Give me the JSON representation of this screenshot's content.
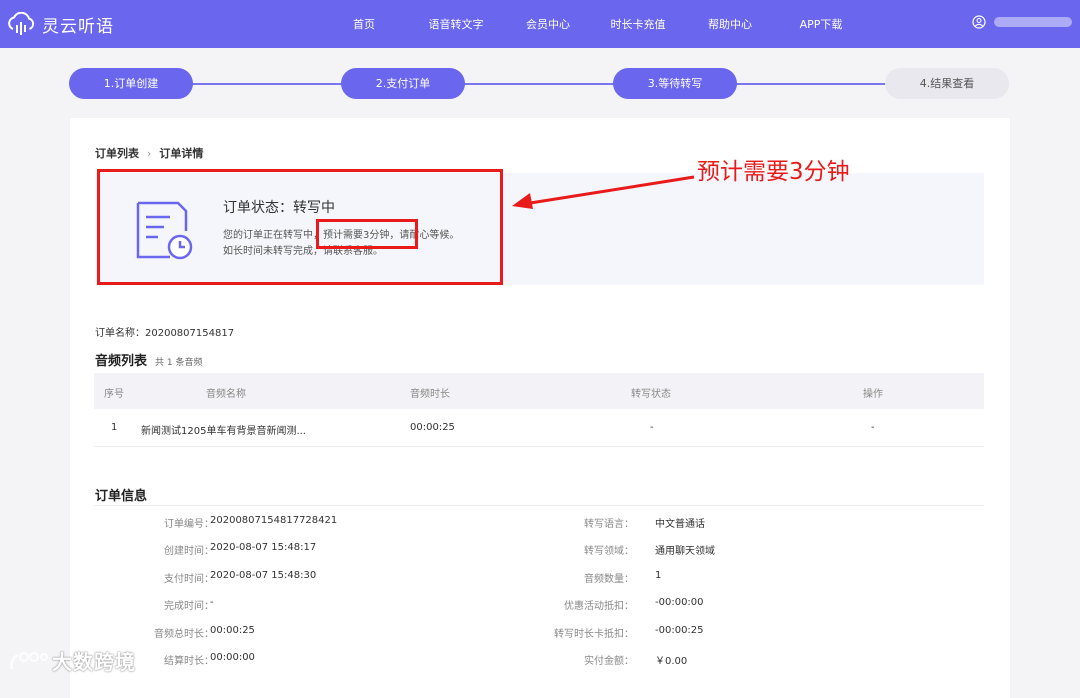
{
  "header": {
    "logo_text": "灵云听语",
    "nav": [
      "首页",
      "语音转文字",
      "会员中心",
      "时长卡充值",
      "帮助中心",
      "APP下载"
    ]
  },
  "steps": [
    {
      "label": "1.订单创建",
      "done": true
    },
    {
      "label": "2.支付订单",
      "done": true
    },
    {
      "label": "3.等待转写",
      "done": true
    },
    {
      "label": "4.结果查看",
      "done": false
    }
  ],
  "breadcrumb": {
    "parent": "订单列表",
    "current": "订单详情"
  },
  "status": {
    "title": "订单状态：转写中",
    "desc_line1": "您的订单正在转写中，预计需要3分钟，请耐心等候。",
    "desc_line2": "如长时间未转写完成，请联系客服。"
  },
  "annotation": {
    "text": "预计需要3分钟"
  },
  "order_name": "订单名称：20200807154817",
  "audio_list": {
    "title": "音频列表",
    "count": "共 1 条音频",
    "columns": [
      "序号",
      "音频名称",
      "音频时长",
      "转写状态",
      "操作"
    ],
    "rows": [
      {
        "index": "1",
        "name": "新闻测试1205单车有背景音新闻测...",
        "duration": "00:00:25",
        "status": "-",
        "action": "-"
      }
    ]
  },
  "order_info": {
    "title": "订单信息",
    "rows": [
      {
        "left_label": "订单编号：",
        "left_value": "20200807154817728421",
        "right_label": "转写语言：",
        "right_value": "中文普通话"
      },
      {
        "left_label": "创建时间：",
        "left_value": "2020-08-07 15:48:17",
        "right_label": "转写领域：",
        "right_value": "通用聊天领域"
      },
      {
        "left_label": "支付时间：",
        "left_value": "2020-08-07 15:48:30",
        "right_label": "音频数量：",
        "right_value": "1"
      },
      {
        "left_label": "完成时间：",
        "left_value": "-",
        "right_label": "优惠活动抵扣：",
        "right_value": "-00:00:00"
      },
      {
        "left_label": "音频总时长：",
        "left_value": "00:00:25",
        "right_label": "转写时长卡抵扣：",
        "right_value": "-00:00:25"
      },
      {
        "left_label": "结算时长：",
        "left_value": "00:00:00",
        "right_label": "实付金额：",
        "right_value": "￥0.00"
      }
    ]
  },
  "watermark": {
    "text": "大数跨境"
  },
  "colors": {
    "brand": "#6a66ee",
    "highlight": "#e81a1a"
  },
  "icons": {
    "logo": "cloud-waveform-icon",
    "user": "user-icon",
    "status": "document-clock-icon",
    "breadcrumb_sep": "chevron-right-icon"
  }
}
